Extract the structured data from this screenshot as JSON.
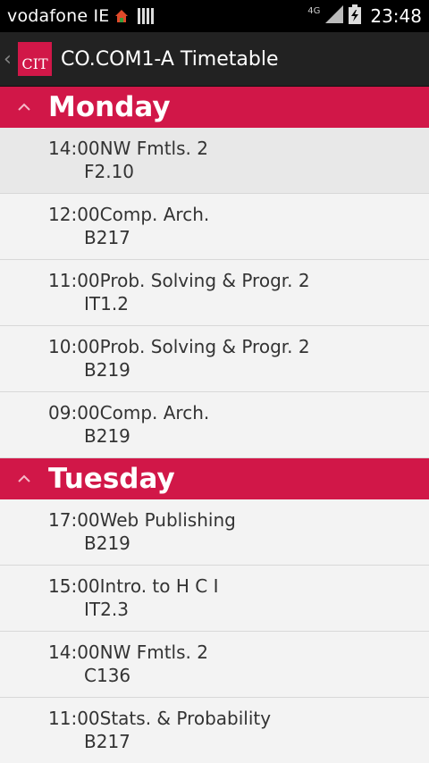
{
  "status_bar": {
    "carrier": "vodafone IE",
    "network": "4G",
    "time": "23:48"
  },
  "action_bar": {
    "logo_text": "CIT",
    "title": "CO.COM1-A Timetable"
  },
  "days": [
    {
      "name": "Monday",
      "entries": [
        {
          "text": "14:00NW Fmtls. 2",
          "room": "F2.10"
        },
        {
          "text": "12:00Comp. Arch.",
          "room": "B217"
        },
        {
          "text": "11:00Prob. Solving & Progr. 2",
          "room": "IT1.2"
        },
        {
          "text": "10:00Prob. Solving & Progr. 2",
          "room": "B219"
        },
        {
          "text": "09:00Comp. Arch.",
          "room": "B219"
        }
      ]
    },
    {
      "name": "Tuesday",
      "entries": [
        {
          "text": "17:00Web Publishing",
          "room": "B219"
        },
        {
          "text": "15:00Intro. to H C I",
          "room": "IT2.3"
        },
        {
          "text": "14:00NW Fmtls. 2",
          "room": "C136"
        },
        {
          "text": "11:00Stats. & Probability",
          "room": "B217"
        }
      ]
    }
  ]
}
